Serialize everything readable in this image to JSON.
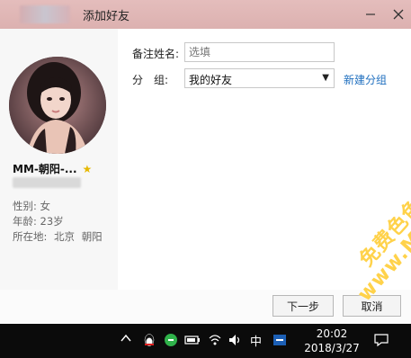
{
  "window": {
    "title": "添加好友",
    "minimize_icon": "minimize-icon",
    "close_icon": "close-icon"
  },
  "profile": {
    "name": "MM-朝阳-...",
    "gender_label": "性别:",
    "gender": "女",
    "age_label": "年龄:",
    "age": "23岁",
    "location_label": "所在地:",
    "location_city1": "北京",
    "location_city2": "朝阳"
  },
  "form": {
    "remark_label": "备注姓名:",
    "remark_placeholder": "选填",
    "group_label": "分　组:",
    "group_selected": "我的好友",
    "new_group_link": "新建分组"
  },
  "buttons": {
    "next": "下一步",
    "cancel": "取消"
  },
  "taskbar": {
    "ime": "中",
    "time": "20:02",
    "date": "2018/3/27"
  },
  "watermark": {
    "line1": "免费色色 -",
    "line2": "www.MFsese.com"
  },
  "colors": {
    "titlebar": "#dcb1b0",
    "link": "#1f6fbf",
    "watermark": "#ffd24a"
  }
}
